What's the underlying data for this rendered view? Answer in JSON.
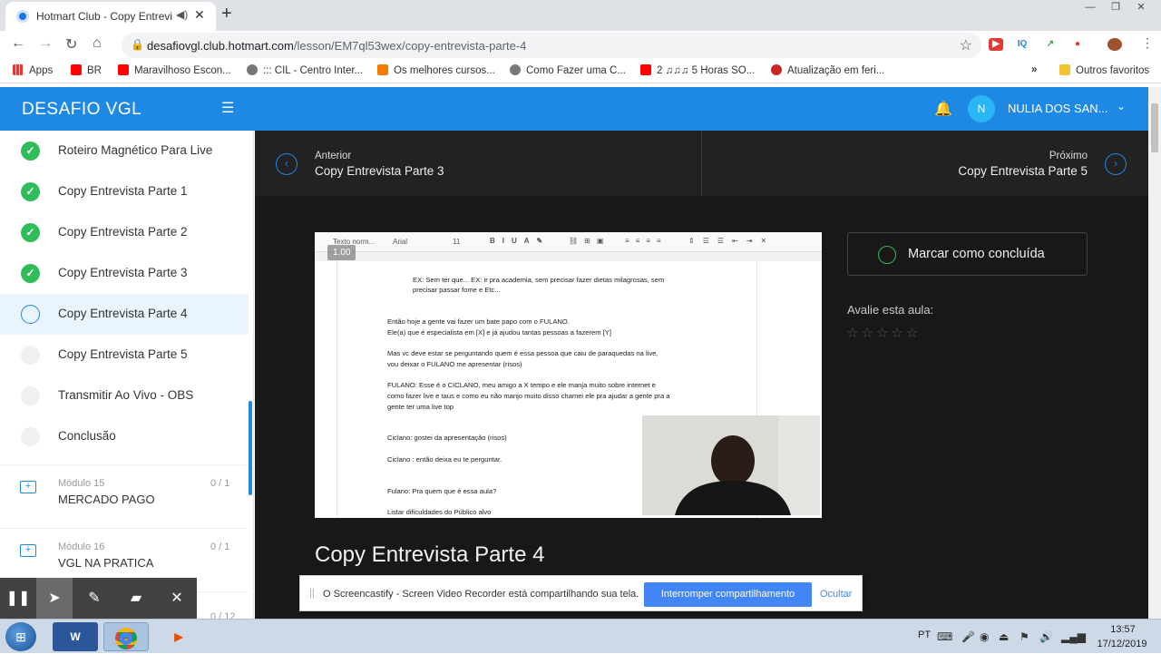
{
  "browser": {
    "tab_title": "Hotmart Club - Copy Entrevi",
    "url_host": "desafiovgl.club.hotmart.com",
    "url_path": "/lesson/EM7ql53wex/copy-entrevista-parte-4",
    "bookmarks": [
      {
        "label": "Apps",
        "icon": "apps-grid-icon",
        "color": "#888"
      },
      {
        "label": "BR",
        "icon": "youtube-icon",
        "color": "#ff0000"
      },
      {
        "label": "Maravilhoso Escon...",
        "icon": "youtube-icon",
        "color": "#ff0000"
      },
      {
        "label": "::: CIL - Centro Inter...",
        "icon": "globe-icon",
        "color": "#666"
      },
      {
        "label": "Os melhores cursos...",
        "icon": "k-icon",
        "color": "#f57c00"
      },
      {
        "label": "Como Fazer uma C...",
        "icon": "globe-icon",
        "color": "#666"
      },
      {
        "label": "2 ♫♫♫ 5 Horas SO...",
        "icon": "youtube-icon",
        "color": "#ff0000"
      },
      {
        "label": "Atualização em feri...",
        "icon": "site-icon",
        "color": "#c62828"
      }
    ],
    "bookmarks_overflow": "»",
    "other_bookmarks": "Outros favoritos"
  },
  "app": {
    "brand": "DESAFIO VGL",
    "user_initial": "N",
    "user_name": "NULIA DOS SAN...",
    "accent": "#1e88e5"
  },
  "sidebar": {
    "lessons": [
      {
        "label": "Roteiro Magnético Para Live",
        "status": "done"
      },
      {
        "label": "Copy Entrevista Parte 1",
        "status": "done"
      },
      {
        "label": "Copy Entrevista Parte 2",
        "status": "done"
      },
      {
        "label": "Copy Entrevista Parte 3",
        "status": "done"
      },
      {
        "label": "Copy Entrevista Parte 4",
        "status": "current"
      },
      {
        "label": "Copy Entrevista Parte 5",
        "status": "todo"
      },
      {
        "label": "Transmitir Ao Vivo - OBS",
        "status": "todo"
      },
      {
        "label": "Conclusão",
        "status": "todo"
      }
    ],
    "modules": [
      {
        "number": "Módulo 15",
        "title": "MERCADO PAGO",
        "count": "0 / 1"
      },
      {
        "number": "Módulo 16",
        "title": "VGL NA PRATICA",
        "count": "0 / 1"
      },
      {
        "number": "",
        "title": "",
        "count": "0 / 12"
      }
    ]
  },
  "nav": {
    "prev_key": "Anterior",
    "prev_title": "Copy Entrevista Parte 3",
    "next_key": "Próximo",
    "next_title": "Copy Entrevista Parte 5"
  },
  "video": {
    "speed": "1.00",
    "toolbar": {
      "style": "Texto norm...",
      "font": "Arial",
      "size": "11"
    },
    "doc_lines": [
      "EX: Sem ter que... EX: ir pra academia, sem precisar fazer dietas milagrosas, sem",
      "precisar passar fome e Etc...",
      "Então hoje a gente vai fazer um bate papo com o FULANO.",
      "Ele(a) que é especialista em [X] e já ajudou tantas pessoas a fazerem [Y]",
      "Mas vc deve estar se perguntando quem é essa pessoa que caiu de paraquedas na live,",
      "vou deixar o FULANO me apresentar (risos)",
      "FULANO: Esse é o CICLANO, meu amigo a X tempo e ele manja muito sobre internet e",
      "como fazer live e taus e como eu não manjo muito disso chamei ele pra ajudar a gente pra a",
      "gente ter uma live top",
      "Ciclano: gostei da apresentação (risos)",
      "Ciclano : então deixa eu te perguntar.",
      "Fulano: Pra quem que é essa aula?",
      "Listar dificuldades do Público alvo"
    ]
  },
  "lesson_title": "Copy Entrevista Parte 4",
  "complete_button": "Marcar como concluída",
  "rate_label": "Avalie esta aula:",
  "rating": {
    "value": 0,
    "max": 5
  },
  "screencastify": {
    "message": "O Screencastify - Screen Video Recorder está compartilhando sua tela.",
    "stop": "Interromper compartilhamento",
    "hide": "Ocultar"
  },
  "taskbar": {
    "lang": "PT",
    "time": "13:57",
    "date": "17/12/2019"
  }
}
